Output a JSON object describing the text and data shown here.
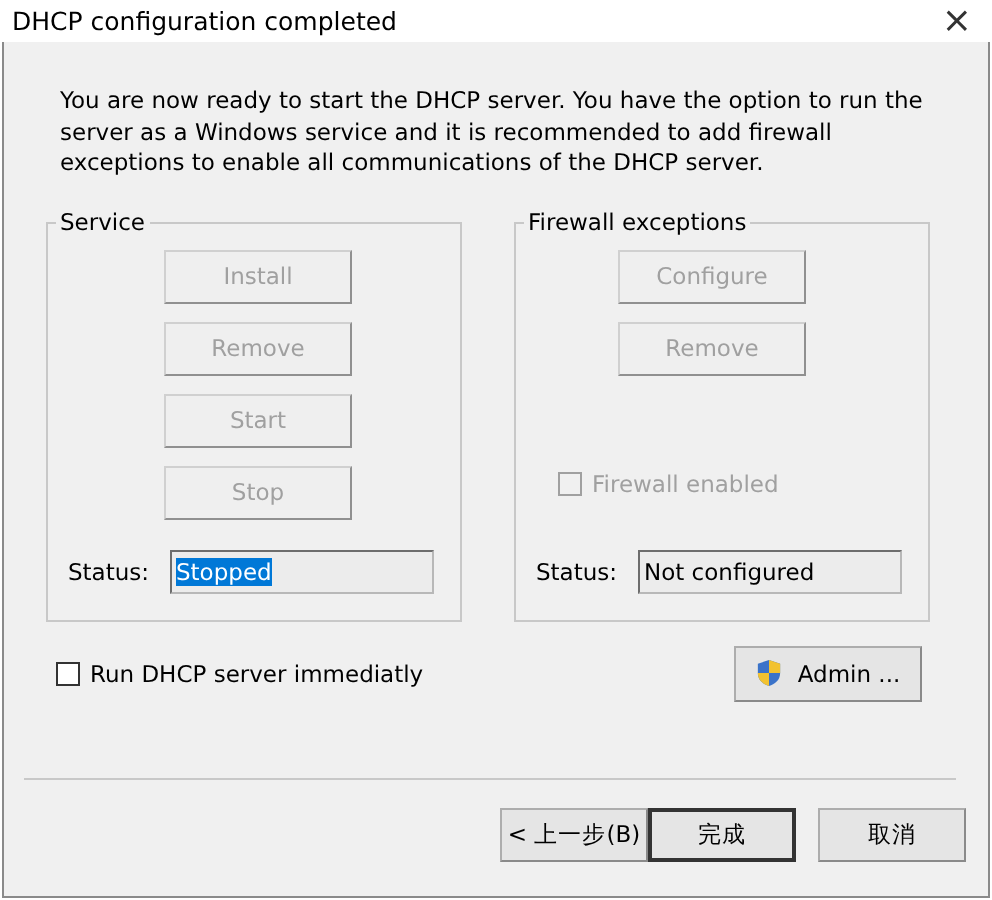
{
  "window": {
    "title": "DHCP configuration completed",
    "close": "×"
  },
  "intro": "You are now ready to start the DHCP server. You have the option to run the server as a Windows service and it is recommended to add firewall exceptions to enable all communications of the DHCP server.",
  "service": {
    "title": "Service",
    "buttons": [
      {
        "label": "Install",
        "disabled": true
      },
      {
        "label": "Remove",
        "disabled": true
      },
      {
        "label": "Start",
        "disabled": true
      },
      {
        "label": "Stop",
        "disabled": true
      }
    ],
    "status_label": "Status:",
    "status": {
      "value": "Stopped",
      "highlighted": true
    }
  },
  "firewall": {
    "title": "Firewall exceptions",
    "buttons": [
      {
        "label": "Configure",
        "disabled": true
      },
      {
        "label": "Remove",
        "disabled": true
      }
    ],
    "checkbox": {
      "label": "Firewall enabled",
      "checked": false,
      "disabled": true
    },
    "status_label": "Status:",
    "status": {
      "value": "Not configured",
      "highlighted": false
    }
  },
  "run_checkbox": {
    "label": "Run DHCP server immediatly",
    "checked": false,
    "disabled": false
  },
  "admin_button": {
    "label": "Admin ...",
    "disabled": false
  },
  "footer_buttons": [
    {
      "label": "< 上一步(B)",
      "default": false
    },
    {
      "label": "完成",
      "default": true
    },
    {
      "label": "取消",
      "default": false
    }
  ]
}
